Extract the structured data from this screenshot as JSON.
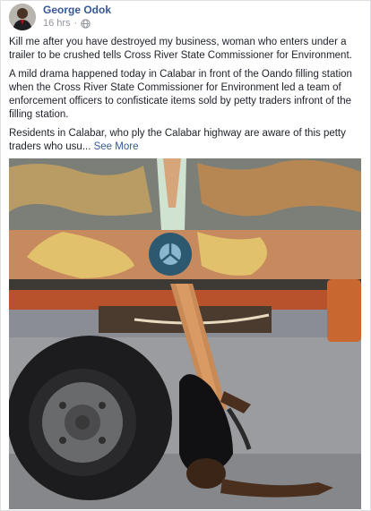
{
  "post": {
    "author": "George Odok",
    "timestamp": "16 hrs",
    "privacy_icon": "globe-icon",
    "paragraphs": [
      "Kill me after you have destroyed my business, woman who enters under a trailer to be crushed tells Cross River State Commissioner for Environment.",
      "A mild drama happened today in Calabar in front of the Oando filling station when the Cross River State Commissioner for Environment led a team of enforcement officers to confisticate items sold by petty traders infront of the filling station."
    ],
    "truncated_paragraph": "Residents in Calabar, who ply the Calabar highway are aware of this petty traders who usu...",
    "see_more_label": "See More"
  },
  "colors": {
    "link": "#365899",
    "meta": "#90949c",
    "text": "#1d2129"
  }
}
